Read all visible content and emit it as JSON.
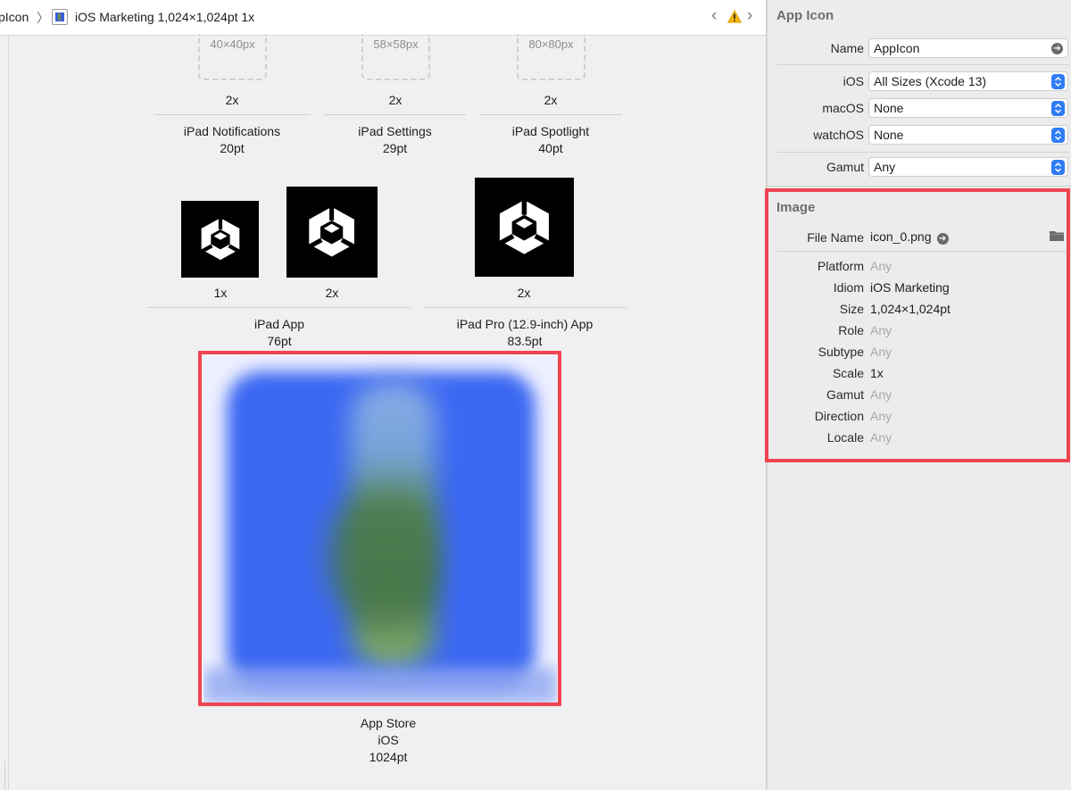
{
  "breadcrumb": {
    "parent": "pIcon",
    "separator": "〉",
    "current": "iOS Marketing 1,024×1,024pt 1x",
    "nav_prev": "‹",
    "nav_next": "›"
  },
  "grid": {
    "row1": [
      {
        "placeholder": "40×40px",
        "scale": "2x",
        "name": "iPad Notifications",
        "size": "20pt"
      },
      {
        "placeholder": "58×58px",
        "scale": "2x",
        "name": "iPad Settings",
        "size": "29pt"
      },
      {
        "placeholder": "80×80px",
        "scale": "2x",
        "name": "iPad Spotlight",
        "size": "40pt"
      }
    ],
    "ipad_app": {
      "scales": [
        "1x",
        "2x"
      ],
      "name": "iPad App",
      "size": "76pt"
    },
    "ipad_pro": {
      "scale": "2x",
      "name": "iPad Pro (12.9-inch) App",
      "size": "83.5pt"
    },
    "app_store": {
      "name": "App Store",
      "platform": "iOS",
      "size": "1024pt"
    }
  },
  "inspector": {
    "app_icon": {
      "title": "App Icon",
      "name_label": "Name",
      "name_value": "AppIcon",
      "ios_label": "iOS",
      "ios_value": "All Sizes (Xcode 13)",
      "macos_label": "macOS",
      "macos_value": "None",
      "watchos_label": "watchOS",
      "watchos_value": "None",
      "gamut_label": "Gamut",
      "gamut_value": "Any"
    },
    "image": {
      "title": "Image",
      "file_name_label": "File Name",
      "file_name_value": "icon_0.png",
      "platform_label": "Platform",
      "platform_value": "Any",
      "idiom_label": "Idiom",
      "idiom_value": "iOS Marketing",
      "size_label": "Size",
      "size_value": "1,024×1,024pt",
      "role_label": "Role",
      "role_value": "Any",
      "subtype_label": "Subtype",
      "subtype_value": "Any",
      "scale_label": "Scale",
      "scale_value": "1x",
      "gamut_label": "Gamut",
      "gamut_value": "Any",
      "direction_label": "Direction",
      "direction_value": "Any",
      "locale_label": "Locale",
      "locale_value": "Any"
    }
  },
  "colors": {
    "highlight": "#f04451",
    "accent": "#2f7cf6",
    "warning": "#f5b800",
    "icon_bg": "#3b68f2"
  },
  "icons": [
    "file-icon",
    "chevron-left-icon",
    "warning-icon",
    "chevron-right-icon",
    "unity-logo-icon",
    "goto-arrow-icon",
    "folder-icon",
    "stepper-icon"
  ]
}
